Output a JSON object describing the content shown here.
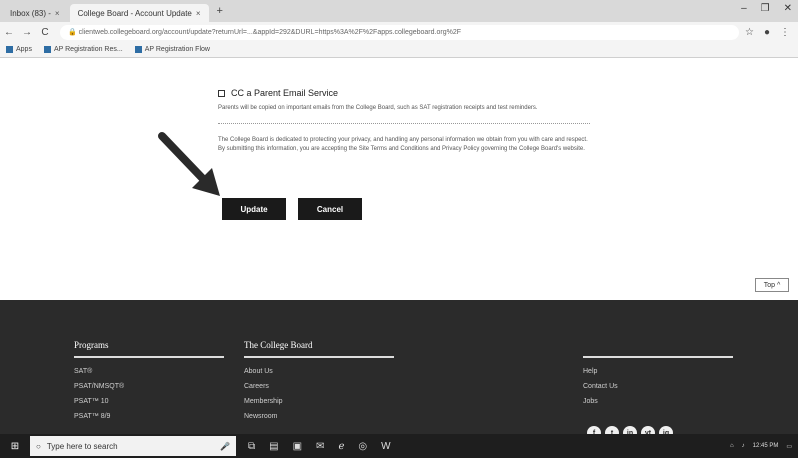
{
  "browser": {
    "tabs": [
      {
        "label": "Inbox (83) - ",
        "active": false
      },
      {
        "label": "College Board - Account Update",
        "active": true
      }
    ],
    "new_tab": "+",
    "window_controls": [
      "–",
      "❐",
      "✕"
    ],
    "url": "clientweb.collegeboard.org/account/update?returnUrl=...&appId=292&DURL=https%3A%2F%2Fapps.collegeboard.org%2F",
    "bookmarks": [
      {
        "label": "Apps",
        "icon": "apps-grid-icon"
      },
      {
        "label": "AP Registration Res...",
        "icon": "bookmark-page-icon"
      },
      {
        "label": "AP Registration Flow",
        "icon": "bookmark-page-icon"
      }
    ]
  },
  "consent": {
    "checkbox_label": "CC a Parent Email Service",
    "hint": "Parents will be copied on important emails from the College Board, such as SAT registration receipts and test reminders.",
    "privacy": "The College Board is dedicated to protecting your privacy, and handling any personal information we obtain from you with care and respect. By submitting this information, you are accepting the Site Terms and Conditions and Privacy Policy governing the College Board's website."
  },
  "actions": {
    "update": "Update",
    "cancel": "Cancel"
  },
  "top_button": "Top ^",
  "footer": {
    "programs": {
      "heading": "Programs",
      "items": [
        "SAT®",
        "PSAT/NMSQT®",
        "PSAT™ 10",
        "PSAT™ 8/9"
      ]
    },
    "college_board": {
      "heading": "The College Board",
      "items": [
        "About Us",
        "Careers",
        "Membership",
        "Newsroom"
      ]
    },
    "links": {
      "items": [
        "Help",
        "Contact Us",
        "Jobs"
      ]
    },
    "social": [
      "f",
      "t",
      "in",
      "yt",
      "ig"
    ]
  },
  "taskbar": {
    "search_placeholder": "Type here to search",
    "tray_time": "12:45 PM"
  }
}
